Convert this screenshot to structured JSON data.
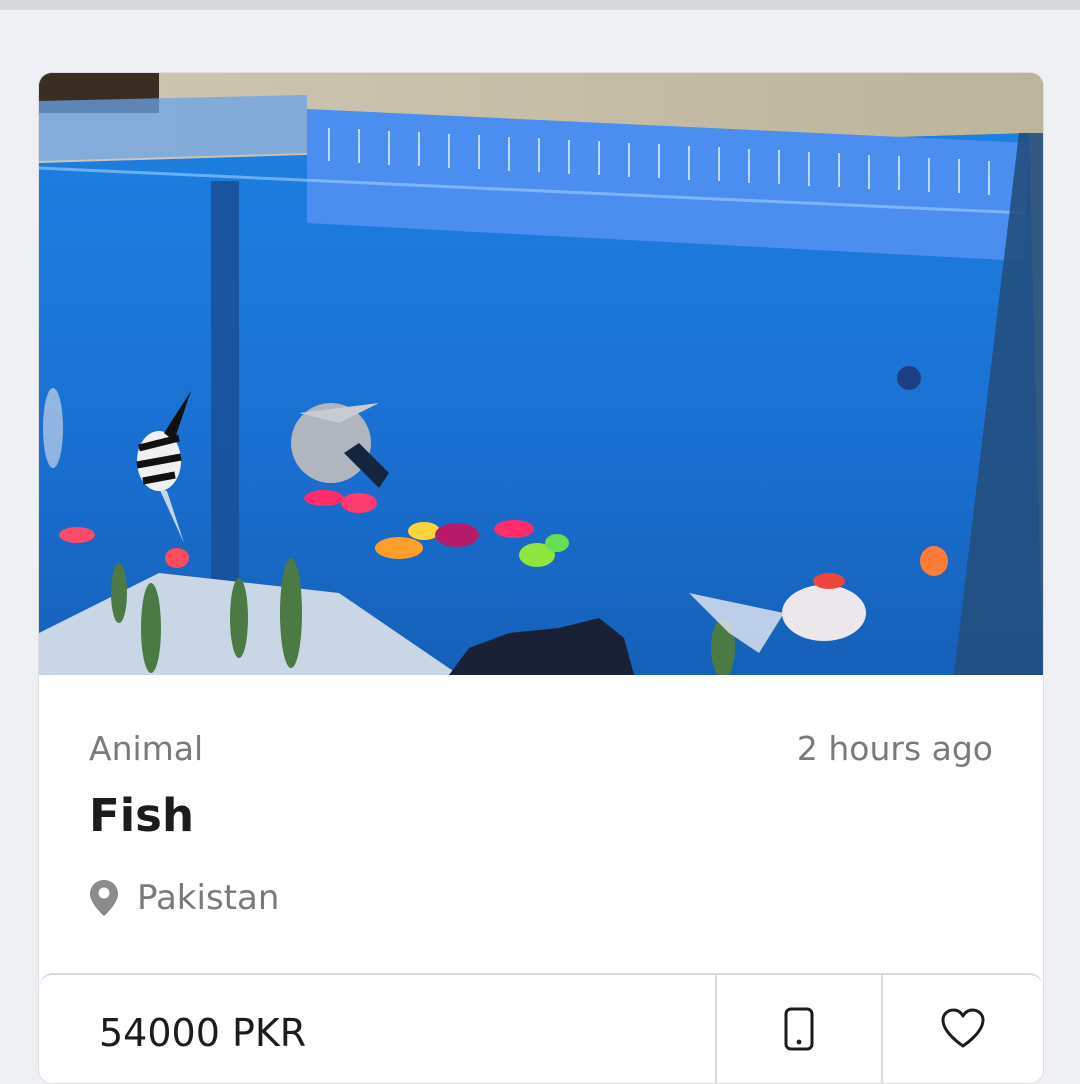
{
  "listing": {
    "image": {
      "subject": "fish-aquarium-photo"
    },
    "category": "Animal",
    "posted": "2 hours ago",
    "title": "Fish",
    "location": "Pakistan",
    "price": "54000 PKR"
  },
  "icons": {
    "location": "location-pin-icon",
    "phone": "phone-icon",
    "favorite": "heart-icon"
  },
  "colors": {
    "page_bg": "#eef0f4",
    "card_bg": "#ffffff",
    "muted_text": "#7a7a7a",
    "primary_text": "#1c1c1c",
    "border": "#d8d9dd"
  }
}
